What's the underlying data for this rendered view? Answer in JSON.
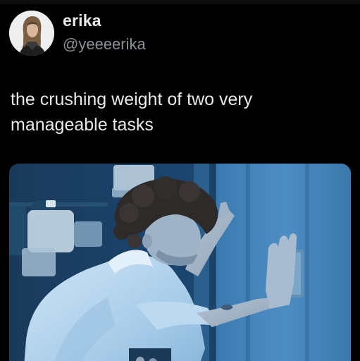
{
  "tweet": {
    "author": {
      "display_name": "erika",
      "handle": "@yeeeerika",
      "avatar_icon": "profile-photo"
    },
    "text": "the crushing weight of two very manageable tasks",
    "media": {
      "type": "photo"
    }
  },
  "colors": {
    "background": "#000000",
    "text_primary": "#e7e9ea",
    "text_secondary": "#8b9096"
  }
}
